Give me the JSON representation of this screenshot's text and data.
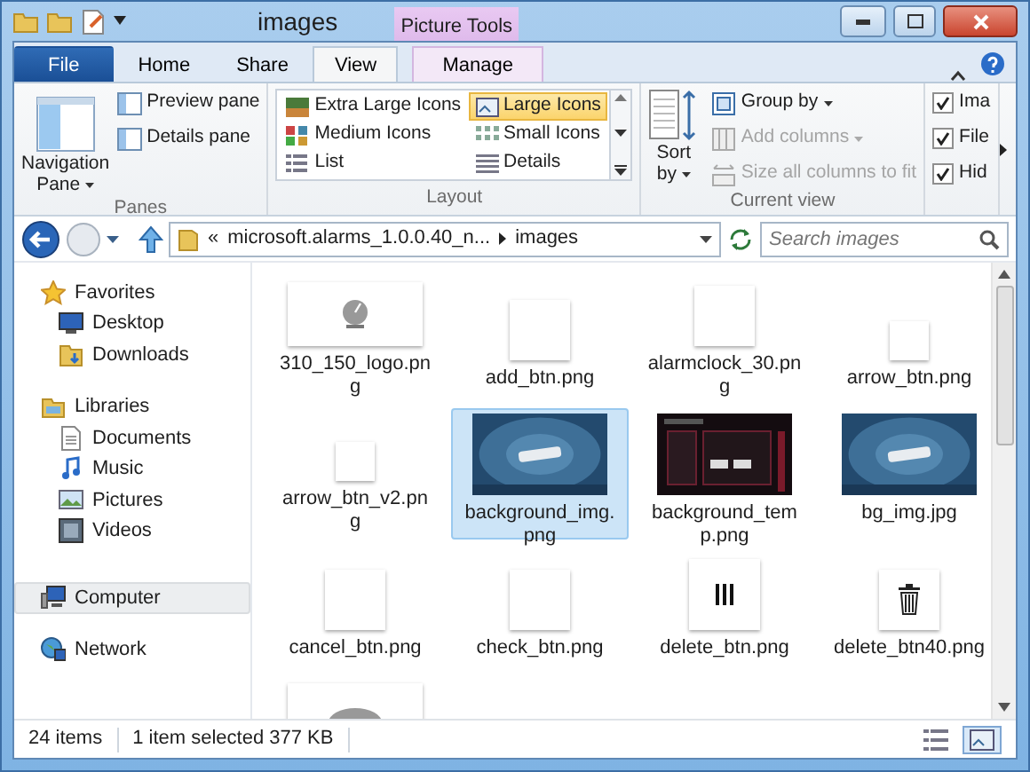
{
  "window": {
    "title": "images",
    "context_tab": "Picture Tools"
  },
  "ribbon_tabs": [
    {
      "label": "File",
      "kind": "file",
      "selected": false
    },
    {
      "label": "Home",
      "kind": "tab",
      "selected": false
    },
    {
      "label": "Share",
      "kind": "tab",
      "selected": false
    },
    {
      "label": "View",
      "kind": "tab",
      "selected": true
    },
    {
      "label": "Manage",
      "kind": "context",
      "selected": false
    }
  ],
  "panes": {
    "label": "Panes",
    "navigation": "Navigation",
    "navigation_2": "Pane",
    "preview": "Preview pane",
    "details": "Details pane"
  },
  "layout": {
    "label": "Layout",
    "options": [
      {
        "label": "Extra Large Icons",
        "selected": false
      },
      {
        "label": "Large Icons",
        "selected": true
      },
      {
        "label": "Medium Icons",
        "selected": false
      },
      {
        "label": "Small Icons",
        "selected": false
      },
      {
        "label": "List",
        "selected": false
      },
      {
        "label": "Details",
        "selected": false
      }
    ]
  },
  "current_view": {
    "label": "Current view",
    "sort": "Sort",
    "sort_2": "by",
    "commands": [
      {
        "label": "Group by",
        "disabled": false
      },
      {
        "label": "Add columns",
        "disabled": true
      },
      {
        "label": "Size all columns to fit",
        "disabled": true
      }
    ]
  },
  "show_hide": [
    {
      "label": "Ima",
      "checked": true
    },
    {
      "label": "File",
      "checked": true
    },
    {
      "label": "Hid",
      "checked": true
    }
  ],
  "address": {
    "overflow": "«",
    "segments": [
      "microsoft.alarms_1.0.0.40_n...",
      "images"
    ],
    "search_placeholder": "Search images"
  },
  "navigation": [
    {
      "label": "Favorites",
      "selected": false,
      "children": [
        {
          "label": "Desktop",
          "selected": false
        },
        {
          "label": "Downloads",
          "selected": false
        }
      ]
    },
    {
      "label": "Libraries",
      "selected": false,
      "children": [
        {
          "label": "Documents",
          "selected": false
        },
        {
          "label": "Music",
          "selected": false
        },
        {
          "label": "Pictures",
          "selected": false
        },
        {
          "label": "Videos",
          "selected": false
        }
      ]
    },
    {
      "label": "Computer",
      "selected": true
    },
    {
      "label": "Network",
      "selected": false
    }
  ],
  "files": [
    {
      "name": "310_150_logo.png",
      "kind": "clock",
      "selected": false
    },
    {
      "name": "add_btn.png",
      "kind": "blank",
      "selected": false
    },
    {
      "name": "alarmclock_30.png",
      "kind": "blank",
      "selected": false
    },
    {
      "name": "arrow_btn.png",
      "kind": "small",
      "selected": false
    },
    {
      "name": "arrow_btn_v2.png",
      "kind": "small",
      "selected": false
    },
    {
      "name": "background_img.png",
      "kind": "picture",
      "selected": true
    },
    {
      "name": "background_temp.png",
      "kind": "dark",
      "selected": false
    },
    {
      "name": "bg_img.jpg",
      "kind": "picture",
      "selected": false
    },
    {
      "name": "cancel_btn.png",
      "kind": "blank",
      "selected": false
    },
    {
      "name": "check_btn.png",
      "kind": "blank",
      "selected": false
    },
    {
      "name": "delete_btn.png",
      "kind": "bars",
      "selected": false
    },
    {
      "name": "delete_btn40.png",
      "kind": "trash",
      "selected": false
    },
    {
      "kind": "partial",
      "selected": false
    }
  ],
  "status_bar": {
    "count": "24 items",
    "selection": "1 item selected  377 KB"
  }
}
